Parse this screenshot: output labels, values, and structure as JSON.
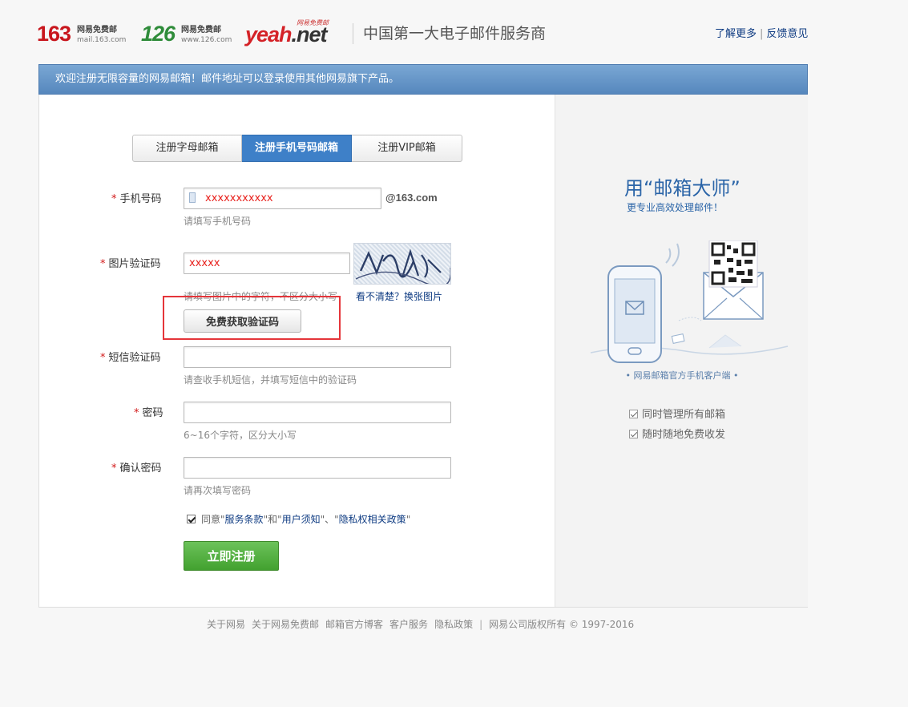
{
  "header": {
    "logo_163": {
      "num": "163",
      "sub1": "网易免费邮",
      "sub2": "mail.163.com"
    },
    "logo_126": {
      "num": "126",
      "sub1": "网易免费邮",
      "sub2": "www.126.com"
    },
    "logo_yeah": {
      "yeah": "yeah",
      "net": ".net",
      "tag": "网易免费邮"
    },
    "slogan": "中国第一大电子邮件服务商",
    "link_more": "了解更多",
    "link_feedback": "反馈意见",
    "link_sep": "|"
  },
  "banner": {
    "text": "欢迎注册无限容量的网易邮箱！邮件地址可以登录使用其他网易旗下产品。"
  },
  "tabs": [
    {
      "label": "注册字母邮箱"
    },
    {
      "label": "注册手机号码邮箱"
    },
    {
      "label": "注册VIP邮箱"
    }
  ],
  "form": {
    "required_mark": "*",
    "phone": {
      "label": "手机号码",
      "value": "xxxxxxxxxxx",
      "suffix": "@163.com",
      "hint": "请填写手机号码"
    },
    "captcha": {
      "label": "图片验证码",
      "value": "xxxxx",
      "hint": "请填写图片中的字符，不区分大小写",
      "refresh_link": "看不清楚？换张图片"
    },
    "sms_button": "免费获取验证码",
    "sms": {
      "label": "短信验证码",
      "value": "",
      "hint": "请查收手机短信，并填写短信中的验证码"
    },
    "password": {
      "label": "密码",
      "value": "",
      "hint": "6~16个字符，区分大小写"
    },
    "confirm": {
      "label": "确认密码",
      "value": "",
      "hint": "请再次填写密码"
    },
    "agree": {
      "prefix": "同意",
      "q1": "\"",
      "terms": "服务条款",
      "q2": "\"和\"",
      "notice": "用户须知",
      "q3": "\"、\"",
      "privacy": "隐私权相关政策",
      "q4": "\"",
      "checked": true
    },
    "submit": "立即注册"
  },
  "promo": {
    "title": "用“邮箱大师”",
    "subtitle": "更专业高效处理邮件！",
    "caption": "• 网易邮箱官方手机客户端 •",
    "features": [
      "同时管理所有邮箱",
      "随时随地免费收发"
    ]
  },
  "footer": {
    "links": [
      "关于网易",
      "关于网易免费邮",
      "邮箱官方博客",
      "客户服务",
      "隐私政策"
    ],
    "sep": "|",
    "copyright": "网易公司版权所有 © 1997-2016"
  },
  "colors": {
    "banner": "#5f8fc4",
    "active_tab": "#3e80c8",
    "submit": "#4aa836",
    "highlight": "#e5353a",
    "required": "#d21a1a"
  }
}
